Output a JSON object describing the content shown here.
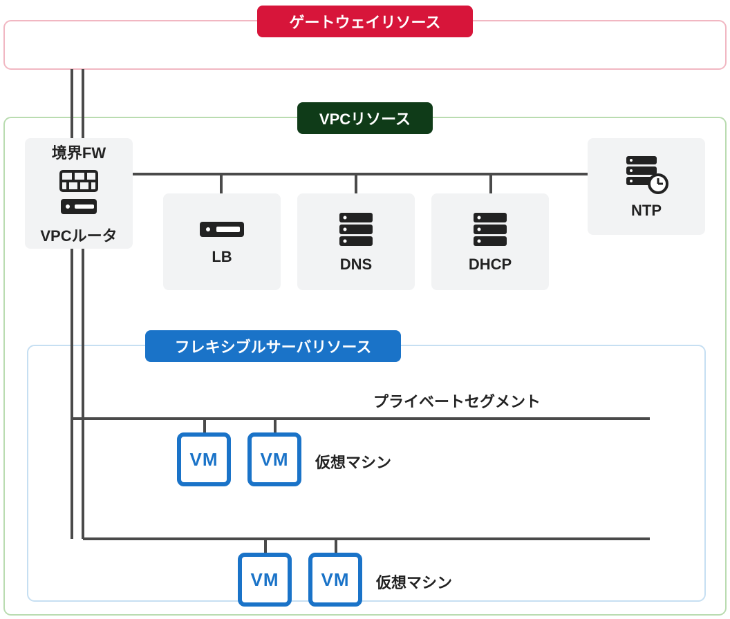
{
  "gateway": {
    "title": "ゲートウェイリソース"
  },
  "vpc": {
    "title": "VPCリソース",
    "nodes": {
      "fw": {
        "top_label": "境界FW",
        "bottom_label": "VPCルータ"
      },
      "lb": {
        "label": "LB"
      },
      "dns": {
        "label": "DNS"
      },
      "dhcp": {
        "label": "DHCP"
      },
      "ntp": {
        "label": "NTP"
      }
    }
  },
  "flex": {
    "title": "フレキシブルサーバリソース",
    "segment_label": "プライベートセグメント",
    "vm_row1_label": "仮想マシン",
    "vm_row2_label": "仮想マシン",
    "vm_badge": "VM"
  },
  "colors": {
    "gateway_border": "#f1b7c2",
    "vpc_border": "#b9dcb0",
    "flex_border": "#c6dff2",
    "line": "#4a4a4a",
    "icon": "#222222",
    "vm_blue": "#1a73c8"
  }
}
